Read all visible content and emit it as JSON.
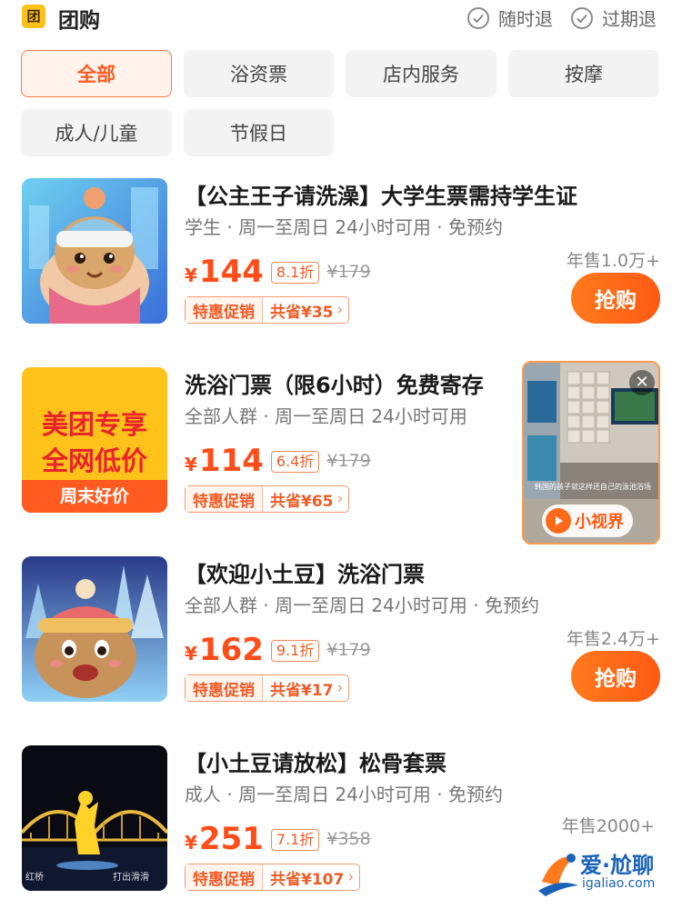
{
  "header": {
    "badge": "团",
    "title": "团购",
    "guarantees": [
      "随时退",
      "过期退"
    ]
  },
  "filters": [
    "全部",
    "浴资票",
    "店内服务",
    "按摩",
    "成人/儿童",
    "节假日"
  ],
  "deals": [
    {
      "title": "【公主王子请洗澡】大学生票需持学生证",
      "meta": "学生 · 周一至周日 24小时可用 · 免预约",
      "yen": "¥",
      "price": "144",
      "discount": "8.1折",
      "original": "¥179",
      "promo_label": "特惠促销",
      "promo_save": "共省¥35",
      "sales": "年售1.0万+",
      "buy_label": "抢购"
    },
    {
      "title": "洗浴门票（限6小时）免费寄存",
      "meta": "全部人群 · 周一至周日 24小时可用",
      "yen": "¥",
      "price": "114",
      "discount": "6.4折",
      "original": "¥179",
      "promo_label": "特惠促销",
      "promo_save": "共省¥65",
      "thumb_lines": [
        "美团专享",
        "全网低价",
        "周末好价"
      ]
    },
    {
      "title": "【欢迎小土豆】洗浴门票",
      "meta": "全部人群 · 周一至周日 24小时可用 · 免预约",
      "yen": "¥",
      "price": "162",
      "discount": "9.1折",
      "original": "¥179",
      "promo_label": "特惠促销",
      "promo_save": "共省¥17",
      "sales": "年售2.4万+",
      "buy_label": "抢购"
    },
    {
      "title": "【小土豆请放松】松骨套票",
      "meta": "成人 · 周一至周日 24小时可用 · 免预约",
      "yen": "¥",
      "price": "251",
      "discount": "7.1折",
      "original": "¥358",
      "promo_label": "特惠促销",
      "promo_save": "共省¥107",
      "sales": "年售2000+",
      "thumb_lines": [
        "红桥",
        "打出滑滑"
      ]
    }
  ],
  "video": {
    "badge": "小视界",
    "close": "✕",
    "caption": "韩国的孩子就这样还自己的泳池浴场"
  },
  "watermark": {
    "text": "爱·尬聊",
    "url": "igaliao.com"
  },
  "colors": {
    "accent": "#ff5a1f",
    "badge_yellow": "#ffc21a",
    "buy_button": "#ff6a1a"
  }
}
